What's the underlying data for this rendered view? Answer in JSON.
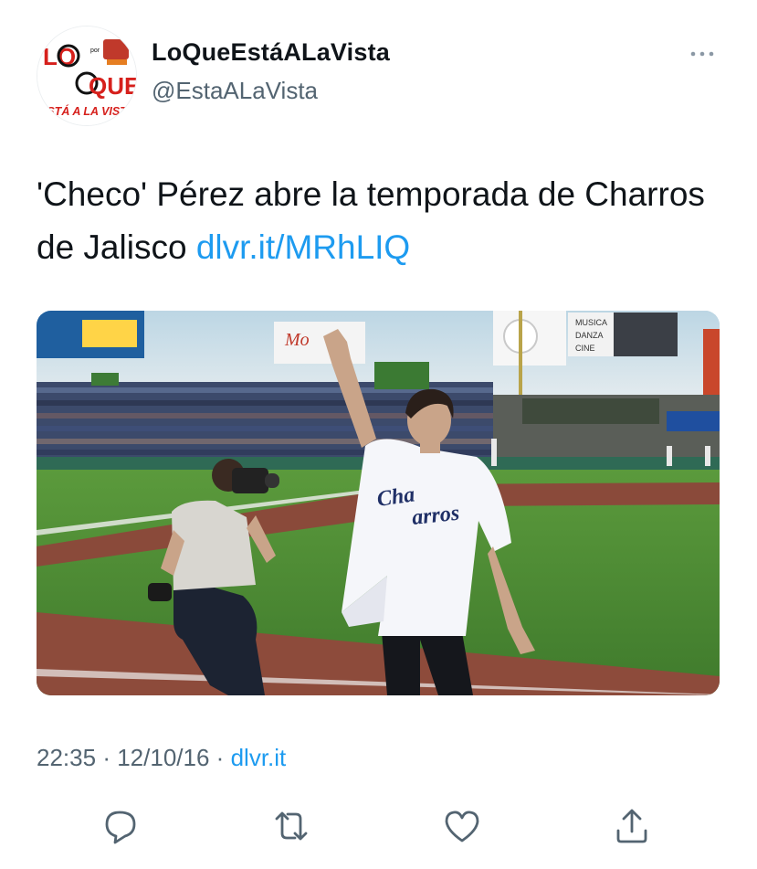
{
  "tweet": {
    "author": {
      "display_name": "LoQueEstáALaVista",
      "handle": "@EstaALaVista",
      "avatar_text": {
        "lo": "LO",
        "por": "por",
        "que": "QUE",
        "bottom": "ESTÁ A LA VISTA"
      }
    },
    "text": "'Checo' Pérez abre la temporada de Charros de Jalisco",
    "link": "dlvr.it/MRhLIQ",
    "time": "22:35",
    "date": "12/10/16",
    "separator": "·",
    "source": "dlvr.it"
  },
  "media": {
    "jersey_text_front": "Cha",
    "jersey_text_side": "arros",
    "billboard_text": [
      "MUSICA",
      "DANZA",
      "CINE"
    ]
  },
  "icons": {
    "more": "more-horizontal-icon",
    "reply": "reply-icon",
    "retweet": "retweet-icon",
    "like": "heart-icon",
    "share": "share-icon"
  },
  "colors": {
    "link": "#1d9bf0",
    "secondary_text": "#536471",
    "primary_text": "#0f1419",
    "avatar_red": "#d6201c"
  }
}
